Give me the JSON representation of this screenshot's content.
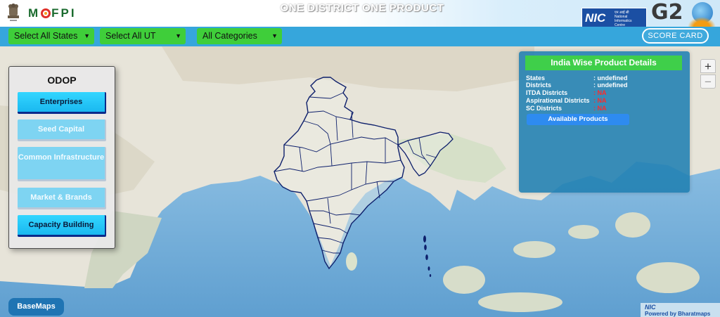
{
  "header": {
    "app_title": "ONE DISTRICT ONE PRODUCT",
    "brand": {
      "prefix": "M",
      "suffix": "FPI"
    },
    "nic": {
      "short": "NIC",
      "sub_lines": [
        "एन आई सी",
        "National",
        "Informatics",
        "Centre"
      ]
    },
    "g20": {
      "text": "G2"
    }
  },
  "filters": {
    "states": "Select All States",
    "ut": "Select All UT",
    "categories": "All Categories"
  },
  "scorecard_label": "SCORE CARD",
  "odop_panel": {
    "title": "ODOP",
    "buttons": [
      {
        "label": "Enterprises",
        "state": "active"
      },
      {
        "label": "Seed Capital",
        "state": "inactive"
      },
      {
        "label": "Common Infrastructure",
        "state": "inactive"
      },
      {
        "label": "Market & Brands",
        "state": "inactive"
      },
      {
        "label": "Capacity Building",
        "state": "active"
      }
    ]
  },
  "details_panel": {
    "title": "India Wise Product Details",
    "rows": [
      {
        "label": "States",
        "value": ": undefined"
      },
      {
        "label": "Districts",
        "value": ": undefined"
      },
      {
        "label": "ITDA Districts",
        "value": ": NA"
      },
      {
        "label": "Aspirational Districts",
        "value": ": NA"
      },
      {
        "label": "SC Districts",
        "value": ": NA"
      }
    ],
    "button": "Available Products"
  },
  "zoom": {
    "in": "+",
    "out": "−"
  },
  "basemaps_label": "BaseMaps",
  "credit": {
    "nic": "NIC",
    "powered": "Powered by Bharatmaps"
  },
  "colors": {
    "header_bar": "#36a6dc",
    "select_green": "#3fce3a",
    "panel_blue": "#2080b2",
    "na_red": "#ff2a2a",
    "map_boundary": "#0d1f6b"
  }
}
